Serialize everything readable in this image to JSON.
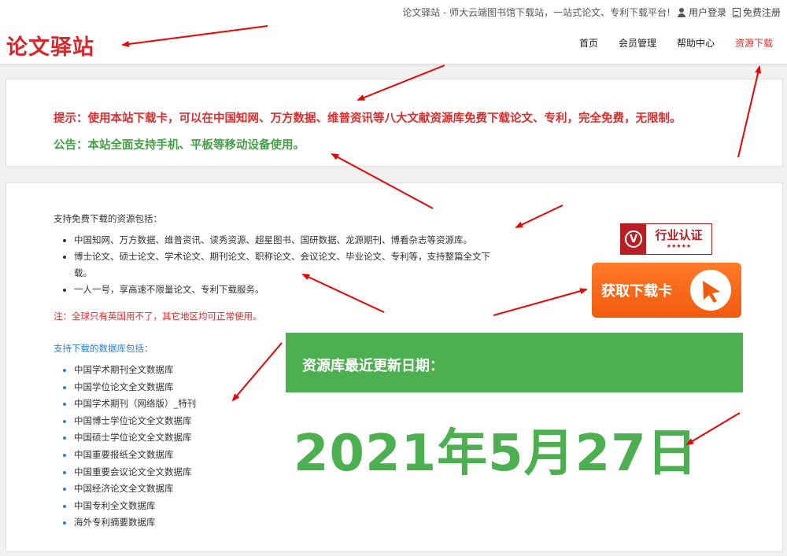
{
  "header": {
    "tagline": "论文驿站 - 师大云端图书馆下载站，一站式论文、专利下载平台!",
    "login_label": "用户登录",
    "register_label": "免费注册",
    "logo_text": "论文驿站",
    "nav": [
      {
        "label": "首页"
      },
      {
        "label": "会员管理"
      },
      {
        "label": "帮助中心"
      },
      {
        "label": "资源下载"
      }
    ]
  },
  "notice": {
    "tip": "提示：使用本站下载卡，可以在中国知网、万方数据、维普资讯等八大文献资源库免费下载论文、专利，完全免费，无限制。",
    "announcement": "公告：本站全面支持手机、平板等移动设备使用。"
  },
  "main": {
    "intro": "支持免费下载的资源包括：",
    "resources": [
      "中国知网、万方数据、维普资讯、读秀资源、超星图书、国研数据、龙源期刊、博看杂志等资源库。",
      "博士论文、硕士论文、学术论文、期刊论文、职称论文、会议论文、毕业论文、专利等，支持整篇全文下载。",
      "一人一号，享高速不限量论文、专利下载服务。"
    ],
    "note": "注：全球只有英国用不了，其它地区均可正常使用。",
    "db_title": "支持下载的数据库包括：",
    "databases": [
      "中国学术期刊全文数据库",
      "中国学位论文全文数据库",
      "中国学术期刊（网络版）_特刊",
      "中国博士学位论文全文数据库",
      "中国硕士学位论文全文数据库",
      "中国重要报纸全文数据库",
      "中国重要会议论文全文数据库",
      "中国经济论文全文数据库",
      "中国专利全文数据库",
      "海外专利摘要数据库"
    ]
  },
  "badge": {
    "v_letter": "V",
    "title": "行业认证",
    "stars": "★★★★★"
  },
  "cta": {
    "label": "获取下载卡"
  },
  "update": {
    "label": "资源库最近更新日期：",
    "date": "2021年5月27日"
  },
  "colors": {
    "brand_red": "#d9262b",
    "green": "#4caf50",
    "orange": "#f25a0c",
    "link_blue": "#2a7fd4",
    "annotation_red": "#ee0000"
  }
}
